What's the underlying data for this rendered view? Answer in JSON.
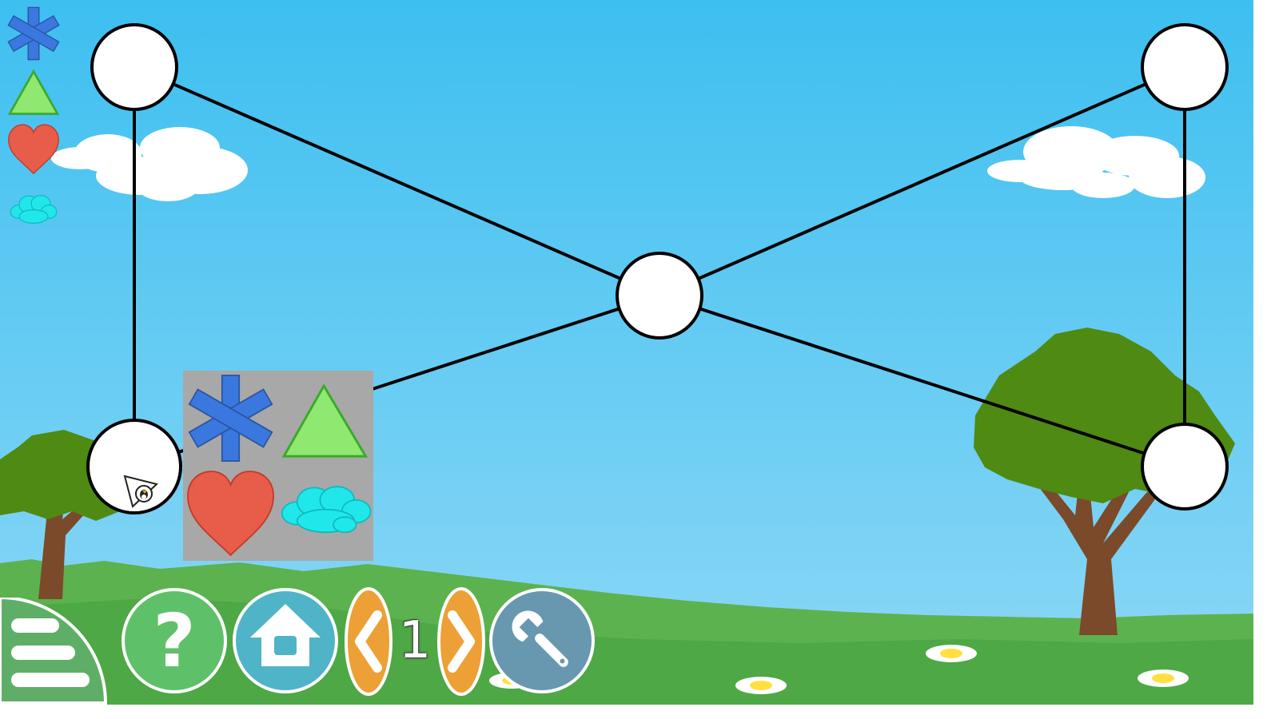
{
  "game": {
    "shapes": [
      "asterisk",
      "triangle",
      "heart",
      "cloud"
    ],
    "colors": {
      "asterisk": "#3a78e0",
      "triangle": "#8fe870",
      "heart": "#e85c4a",
      "cloud": "#20e8ea",
      "sky_top": "#3dbff0",
      "sky_bottom": "#8ed8f6",
      "grass": "#4ea845",
      "tree": "#4f8a12",
      "trunk": "#7a4a2a",
      "help_button": "#5fc06a",
      "home_button": "#4fb4c8",
      "nav_button": "#eda035",
      "settings_button": "#6898b0",
      "popup": "#a8a8a8"
    },
    "nodes_filled": 0,
    "nodes_total": 5,
    "edges_total": 6
  },
  "toolbar": {
    "menu_icon": "hamburger-icon",
    "help_icon": "question-mark-icon",
    "help_label": "?",
    "home_icon": "house-icon",
    "prev_icon": "chevron-left-icon",
    "next_icon": "chevron-right-icon",
    "settings_icon": "wrench-icon",
    "level": "1"
  }
}
